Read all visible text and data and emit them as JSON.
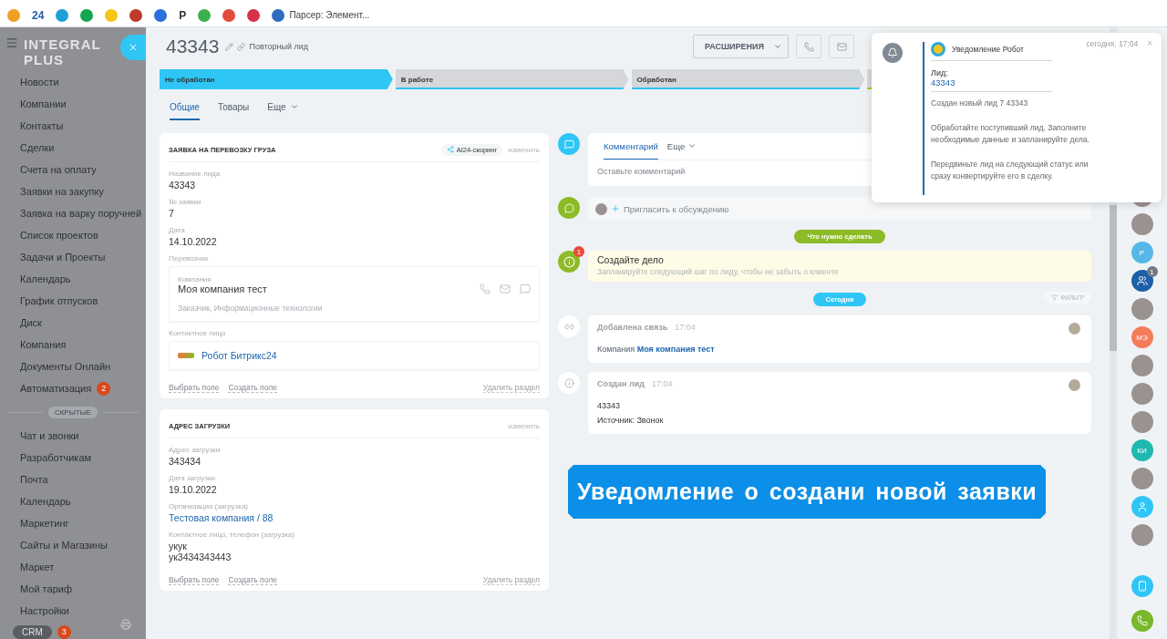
{
  "bookmarks": [
    {
      "kind": "icon",
      "color": "#f0a020"
    },
    {
      "kind": "text",
      "label": "24",
      "color": "#2a5da8"
    },
    {
      "kind": "icon",
      "color": "#1fa0d8"
    },
    {
      "kind": "icon",
      "color": "#12a650"
    },
    {
      "kind": "icon",
      "color": "#f5c518"
    },
    {
      "kind": "icon",
      "color": "#c0392b"
    },
    {
      "kind": "icon",
      "color": "#2a6fdb"
    },
    {
      "kind": "text",
      "label": "P",
      "color": "#333333"
    },
    {
      "kind": "icon",
      "color": "#3cb04a"
    },
    {
      "kind": "icon",
      "color": "#e04b3a"
    },
    {
      "kind": "icon",
      "color": "#d9304a"
    },
    {
      "kind": "link",
      "label": "Парсер: Элемент...",
      "color": "#2d6cc0"
    }
  ],
  "sidebar": {
    "logo": "INTEGRAL PLUS",
    "items": [
      {
        "label": "Новости"
      },
      {
        "label": "Компании"
      },
      {
        "label": "Контакты"
      },
      {
        "label": "Сделки"
      },
      {
        "label": "Счета на оплату"
      },
      {
        "label": "Заявки на закупку"
      },
      {
        "label": "Заявка на варку поручней"
      },
      {
        "label": "Список проектов"
      },
      {
        "label": "Задачи и Проекты"
      },
      {
        "label": "Календарь"
      },
      {
        "label": "График отпусков"
      },
      {
        "label": "Диск"
      },
      {
        "label": "Компания"
      },
      {
        "label": "Документы Онлайн"
      },
      {
        "label": "Автоматизация",
        "counter": "2"
      }
    ],
    "hidden_label": "СКРЫТЫЕ",
    "hidden_items": [
      {
        "label": "Чат и звонки"
      },
      {
        "label": "Разработчикам"
      },
      {
        "label": "Почта"
      },
      {
        "label": "Календарь"
      },
      {
        "label": "Маркетинг"
      },
      {
        "label": "Сайты и Магазины"
      },
      {
        "label": "Маркет"
      },
      {
        "label": "Мой тариф"
      },
      {
        "label": "Настройки"
      }
    ],
    "crm": {
      "label": "CRM",
      "counter": "3"
    }
  },
  "header": {
    "title": "43343",
    "subtitle": "Повторный лид",
    "extensions_button": "РАСШИРЕНИЯ"
  },
  "stages": [
    {
      "label": "Не обработан",
      "selected": true,
      "color": "#2fc6f6"
    },
    {
      "label": "В работе",
      "selected": false,
      "color": "#2fc6f6"
    },
    {
      "label": "Обработан",
      "selected": false,
      "color": "#2fc6f6"
    },
    {
      "selected": false,
      "color": "#9dcf00"
    }
  ],
  "tabs": [
    {
      "label": "Общие",
      "selected": true,
      "kind": "tab"
    },
    {
      "label": "Товары",
      "selected": false,
      "kind": "tab"
    },
    {
      "label": "Еще",
      "selected": false,
      "kind": "menu"
    }
  ],
  "cards": [
    {
      "title": "ЗАЯВКА НА ПЕРЕВОЗКУ ГРУЗА",
      "badge": "AI24-скоринг",
      "action": "изменить",
      "fields": [
        {
          "kind": "text",
          "label": "Название лида",
          "value": "43343"
        },
        {
          "kind": "text",
          "label": "№ заявки",
          "value": "7"
        },
        {
          "kind": "text",
          "label": "Дата",
          "value": "14.10.2022"
        },
        {
          "kind": "company",
          "label": "Перевозчик",
          "caption": "Компания",
          "value": "Моя компания тест",
          "details": "Заказчик, Информационные технологии"
        },
        {
          "kind": "contact",
          "label": "Контактное лицо",
          "value": "Робот Битрикс24"
        }
      ],
      "links": [
        "Выбрать поле",
        "Создать поле"
      ],
      "remove": "Удалить раздел"
    },
    {
      "title": "АДРЕС ЗАГРУЗКИ",
      "action": "изменить",
      "fields": [
        {
          "kind": "text",
          "label": "Адрес загрузки",
          "value": "343434"
        },
        {
          "kind": "text",
          "label": "Дата загрузки",
          "value": "19.10.2022"
        },
        {
          "kind": "link",
          "label": "Организация (загрузка)",
          "value": "Тестовая компания / 88"
        },
        {
          "kind": "lines",
          "label": "Контактное лицо, телефон (загрузка)",
          "values": [
            "укук",
            "ук3434343443"
          ]
        }
      ],
      "links": [
        "Выбрать поле",
        "Создать поле"
      ],
      "remove": "Удалить раздел"
    }
  ],
  "timeline": {
    "composer": {
      "tabs": [
        {
          "label": "Комментарий",
          "selected": true,
          "kind": "tab"
        },
        {
          "label": "Еще",
          "selected": false,
          "kind": "menu"
        }
      ],
      "placeholder": "Оставьте комментарий"
    },
    "invite": "Пригласить к обсуждению",
    "todo_pill": "Что нужно сделать",
    "todo": {
      "title": "Создайте дело",
      "hint": "Запланируйте следующий шаг по лиду, чтобы не забыть о клиенте",
      "counter": "1"
    },
    "today_pill": "Сегодня",
    "filter": "ФИЛЬТР",
    "events": [
      {
        "kind": "link",
        "title": "Добавлена связь",
        "time": "17:04",
        "label": "Компания",
        "link": "Моя компания тест"
      },
      {
        "kind": "created",
        "title": "Создан лид",
        "time": "17:04",
        "lines": [
          "43343",
          "Источник: Звонок"
        ]
      }
    ]
  },
  "right_rail": {
    "items": [
      {
        "kind": "photo"
      },
      {
        "kind": "photo"
      },
      {
        "kind": "initials",
        "label": "Р",
        "color": "#55b8e8"
      },
      {
        "kind": "chat",
        "color": "#1d5fa8",
        "counter": "1"
      },
      {
        "kind": "photo"
      },
      {
        "kind": "initials",
        "label": "МЭ",
        "color": "#f47c5a"
      },
      {
        "kind": "photo"
      },
      {
        "kind": "photo"
      },
      {
        "kind": "photo"
      },
      {
        "kind": "initials",
        "label": "КИ",
        "color": "#1fb9b0"
      },
      {
        "kind": "photo"
      },
      {
        "kind": "user",
        "color": "#2fc6f6"
      },
      {
        "kind": "photo"
      }
    ],
    "bottom": [
      {
        "kind": "device",
        "color": "#2fc6f6"
      },
      {
        "kind": "phone",
        "color": "#78b829"
      }
    ]
  },
  "notification": {
    "time": "сегодня, 17:04",
    "close": "×",
    "sender": "Уведомление Робот",
    "lead_label": "Лид:",
    "lead_link": "43343",
    "created": "Создан новый лид 7 43343",
    "paragraphs": [
      "Обработайте поступивший лид. Заполните необходимые данные и запланируйте дела.",
      "Передвиньте лид на следующий статус или сразу конвертируйте его в сделку."
    ]
  },
  "caption": "Уведомление о создани новой заявки"
}
